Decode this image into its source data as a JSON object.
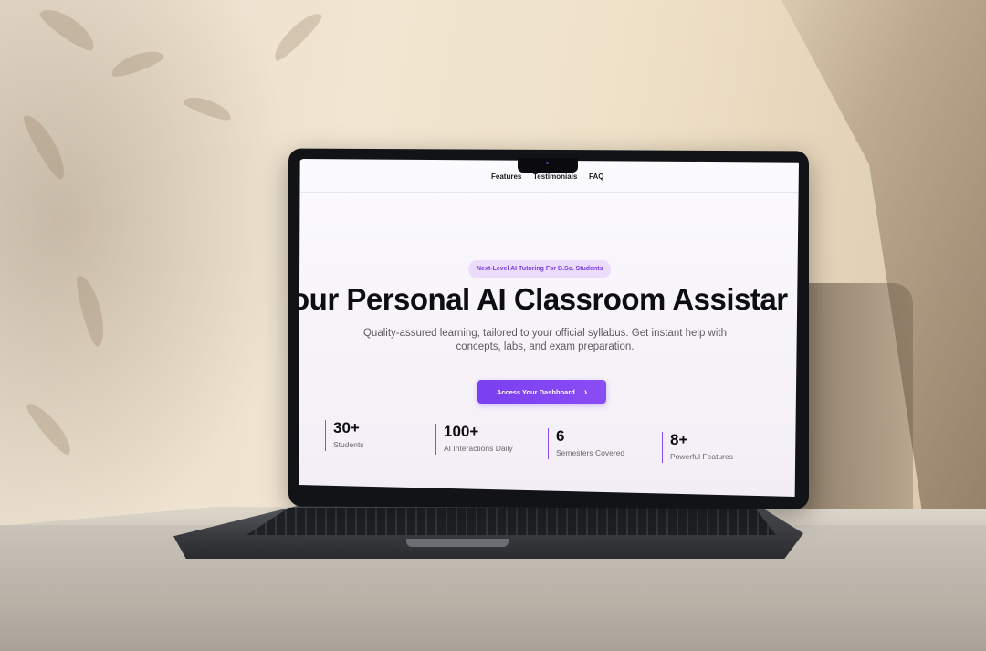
{
  "nav": {
    "items": [
      {
        "label": "Features"
      },
      {
        "label": "Testimonials"
      },
      {
        "label": "FAQ"
      }
    ]
  },
  "hero": {
    "badge": "Next-Level AI Tutoring For B.Sc. Students",
    "title": "our Personal AI Classroom Assistar",
    "subtitle": "Quality-assured learning, tailored to your official syllabus. Get instant help with concepts, labs, and exam preparation.",
    "cta_label": "Access Your Dashboard",
    "cta_icon": "chevron-right-icon"
  },
  "stats": [
    {
      "value": "30+",
      "label": "Students"
    },
    {
      "value": "100+",
      "label": "AI Interactions Daily"
    },
    {
      "value": "6",
      "label": "Semesters Covered"
    },
    {
      "value": "8+",
      "label": "Powerful Features"
    }
  ],
  "colors": {
    "accent": "#7a3ff0",
    "badge_bg": "#ebdcfb",
    "text_dark": "#0d0d12"
  }
}
